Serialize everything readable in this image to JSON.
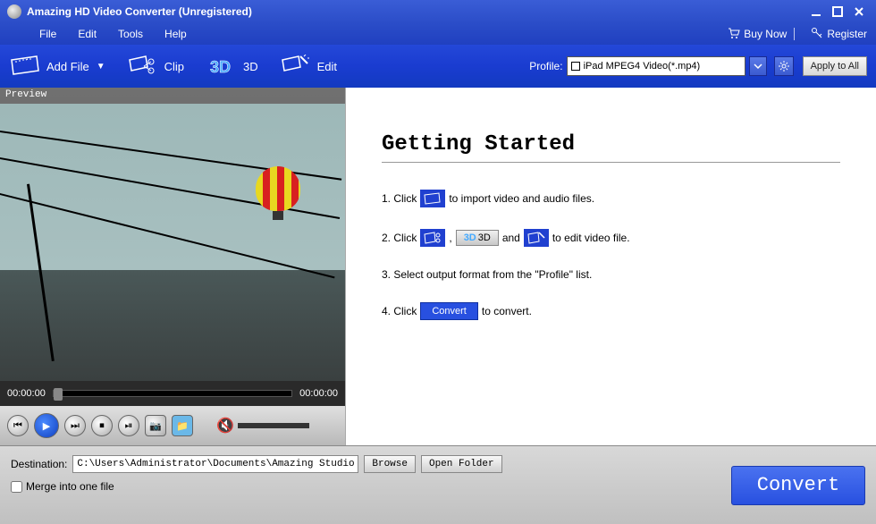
{
  "window": {
    "title": "Amazing HD Video Converter (Unregistered)"
  },
  "menu": {
    "file": "File",
    "edit": "Edit",
    "tools": "Tools",
    "help": "Help",
    "buy": "Buy Now",
    "register": "Register"
  },
  "toolbar": {
    "add_file": "Add File",
    "clip": "Clip",
    "threeD": "3D",
    "edit": "Edit",
    "profile_label": "Profile:",
    "profile_value": "iPad MPEG4 Video(*.mp4)",
    "apply_all": "Apply to All"
  },
  "preview": {
    "label": "Preview",
    "time_current": "00:00:00",
    "time_total": "00:00:00"
  },
  "getting_started": {
    "title": "Getting Started",
    "s1a": "1. Click",
    "s1b": "to import video and audio files.",
    "s2a": "2. Click",
    "s2b": ",",
    "s2c": "3D",
    "s2d": "and",
    "s2e": "to edit video file.",
    "s3": "3. Select output format from the \"Profile\" list.",
    "s4a": "4. Click",
    "s4b": "Convert",
    "s4c": "to convert."
  },
  "bottom": {
    "dest_label": "Destination:",
    "dest_value": "C:\\Users\\Administrator\\Documents\\Amazing Studio\\",
    "browse": "Browse",
    "open_folder": "Open Folder",
    "merge": "Merge into one file",
    "convert": "Convert"
  }
}
